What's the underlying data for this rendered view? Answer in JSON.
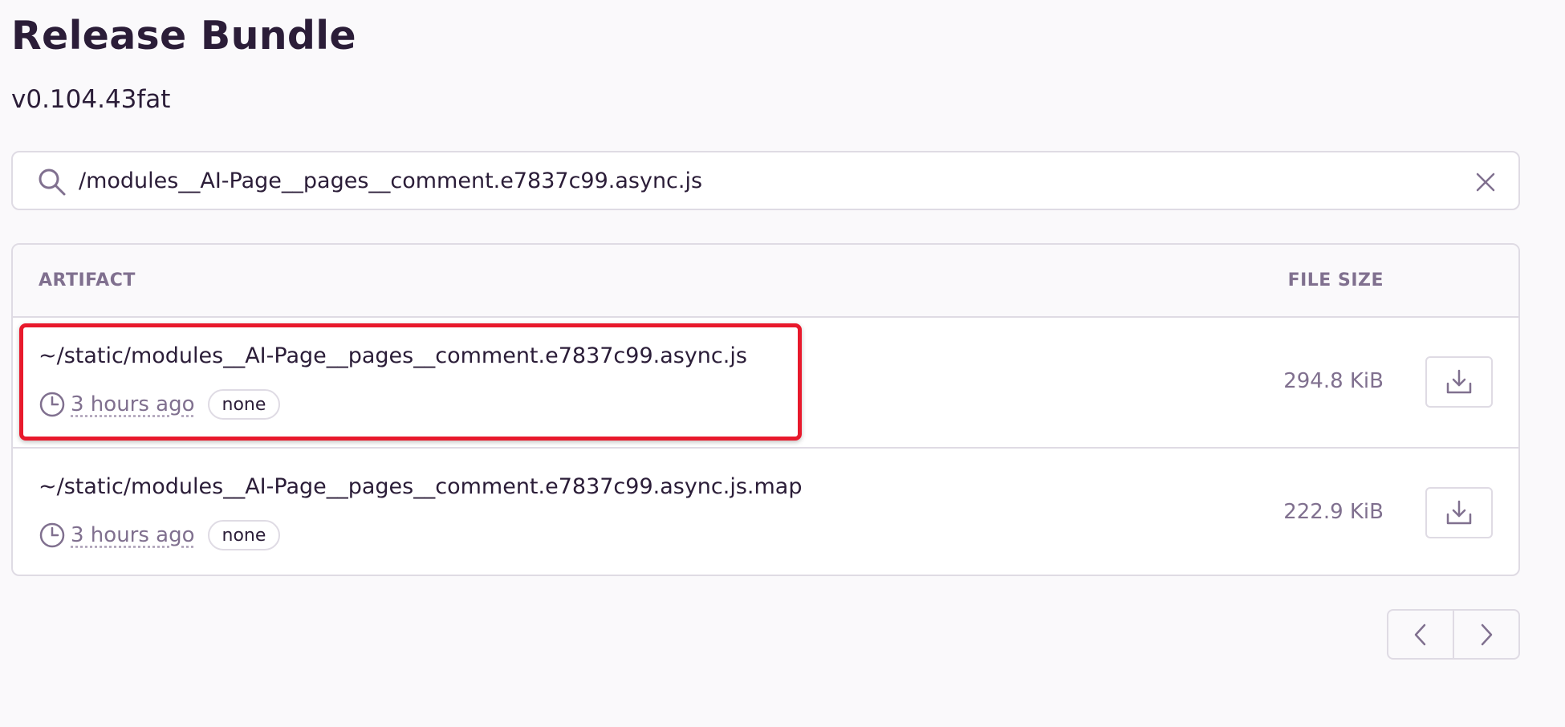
{
  "page": {
    "title": "Release Bundle",
    "version": "v0.104.43fat"
  },
  "search": {
    "value": "/modules__AI-Page__pages__comment.e7837c99.async.js",
    "search_icon": "search-icon",
    "clear_icon": "close-icon"
  },
  "table": {
    "headers": {
      "artifact": "ARTIFACT",
      "file_size": "FILE SIZE"
    },
    "rows": [
      {
        "name": "~/static/modules__AI-Page__pages__comment.e7837c99.async.js",
        "time": "3 hours ago",
        "tag": "none",
        "size": "294.8 KiB",
        "highlighted": true
      },
      {
        "name": "~/static/modules__AI-Page__pages__comment.e7837c99.async.js.map",
        "time": "3 hours ago",
        "tag": "none",
        "size": "222.9 KiB",
        "highlighted": false
      }
    ]
  },
  "icons": {
    "clock": "clock-icon",
    "download": "download-icon",
    "prev": "chevron-left-icon",
    "next": "chevron-right-icon"
  },
  "colors": {
    "highlight": "#e8192c",
    "muted_text": "#80708f",
    "border": "#dfdbe4"
  }
}
